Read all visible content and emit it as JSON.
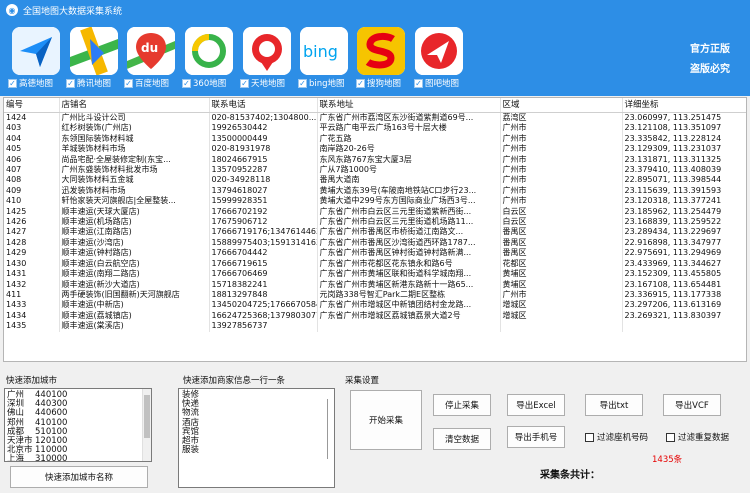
{
  "window": {
    "title": "全国地图大数据采集系统"
  },
  "apps": [
    {
      "label": "高德地图",
      "icon": "amap-icon",
      "color": "#1d8ef7"
    },
    {
      "label": "腾讯地图",
      "icon": "tencent-map-icon",
      "color": "#2c7cf6"
    },
    {
      "label": "百度地图",
      "icon": "baidu-map-icon",
      "color": "#e63a2e"
    },
    {
      "label": "360地图",
      "icon": "360-map-icon",
      "color": "#38b34a"
    },
    {
      "label": "天地地图",
      "icon": "tianditu-icon",
      "color": "#e8262a"
    },
    {
      "label": "bing地图",
      "icon": "bing-map-icon",
      "color": "#00a4ef"
    },
    {
      "label": "搜狗地图",
      "icon": "sogou-map-icon",
      "color": "#e60012"
    },
    {
      "label": "图吧地图",
      "icon": "mapbar-icon",
      "color": "#1d63c8"
    }
  ],
  "banner": {
    "official": "官方正版",
    "piracy": "盗版必究"
  },
  "table": {
    "columns": [
      "编号",
      "店铺名",
      "联系电话",
      "联系地址",
      "区域",
      "详细坐标"
    ],
    "rows": [
      [
        "1424",
        "广州比斗设计公司",
        "020-81537402;1304800...",
        "广东省广州市荔湾区东沙街道紫荆道69号...",
        "荔湾区",
        "23.060997, 113.251475"
      ],
      [
        "403",
        "红杉树装饰(广州店)",
        "19926530442",
        "平云路广电平云广场163号十层大楼",
        "广州市",
        "23.121108, 113.351097"
      ],
      [
        "404",
        "东领国际装饰材料城",
        "13500000449",
        "广花五路",
        "广州市",
        "23.335842, 113.228124"
      ],
      [
        "405",
        "羊城装饰材料市场",
        "020-81931978",
        "南岸路20-26号",
        "广州市",
        "23.129309, 113.231037"
      ],
      [
        "406",
        "尚品宅配·全屋装修定制(东宝...",
        "18024667915",
        "东风东路767东宝大厦3层",
        "广州市",
        "23.131871, 113.311325"
      ],
      [
        "407",
        "广州东盛装饰材料批发市场",
        "13570952287",
        "广从7路1000号",
        "广州市",
        "23.379410, 113.408039"
      ],
      [
        "408",
        "大同装饰材料五金城",
        "020-34928118",
        "番禺大道南",
        "广州市",
        "22.895071, 113.398544"
      ],
      [
        "409",
        "迅发装饰材料市场",
        "13794618027",
        "黄埔大道东39号(车陂南地铁站C口步行23...",
        "广州市",
        "23.115639, 113.391593"
      ],
      [
        "410",
        "轩怡家装天河旗舰店|全屋整装...",
        "15999928351",
        "黄埔大道中299号东方国际商业广场西3号...",
        "广州市",
        "23.120318, 113.377241"
      ],
      [
        "1425",
        "顺丰速运(天球大厦店)",
        "17666702192",
        "广东省广州市白云区三元里街道紫新西街...",
        "白云区",
        "23.185962, 113.254479"
      ],
      [
        "1426",
        "顺丰速运(机场路店)",
        "17675906712",
        "广东省广州市白云区三元里街道机场路11...",
        "白云区",
        "23.168839, 113.259522"
      ],
      [
        "1427",
        "顺丰速运(江南路店)",
        "17666719176;13476144636",
        "广东省广州市番禺区市桥街道江南路文...",
        "番禺区",
        "23.289434, 113.229697"
      ],
      [
        "1428",
        "顺丰速运(沙湾店)",
        "15889975403;15913141633",
        "广东省广州市番禺区沙湾街道西环路1787...",
        "番禺区",
        "22.916898, 113.347977"
      ],
      [
        "1429",
        "顺丰速运(钟村路店)",
        "17666704442",
        "广东省广州市番禺区钟村街道钟村路新满...",
        "番禺区",
        "22.975691, 113.294969"
      ],
      [
        "1430",
        "顺丰速运(白云航空店)",
        "17666719615",
        "广东省广州市花都区花东镇永和路6号",
        "花都区",
        "23.433969, 113.344627"
      ],
      [
        "1431",
        "顺丰速运(南翔二路店)",
        "17666706469",
        "广东省广州市黄埔区联和街道科学城南翔...",
        "黄埔区",
        "23.152309, 113.455805"
      ],
      [
        "1432",
        "顺丰速运(新沙大道店)",
        "15718382241",
        "广东省广州市黄埔区新港东路新十一路65...",
        "黄埔区",
        "23.167108, 113.654481"
      ],
      [
        "411",
        "两手硬装饰(旧国翻新)天河旗舰店",
        "18813297848",
        "元岗路338号智汇Park二期E区整栋",
        "广州市",
        "23.336915, 113.177338"
      ],
      [
        "1433",
        "顺丰速运(中新店)",
        "13450204725;17666705847",
        "广东省广州市增城区中新镇团结村金龙路...",
        "增城区",
        "23.297206, 113.613169"
      ],
      [
        "1434",
        "顺丰速运(荔城镇店)",
        "16624725368;13798030773",
        "广东省广州市增城区荔城镇荔景大道2号",
        "增城区",
        "23.269321, 113.830397"
      ],
      [
        "1435",
        "顺丰速运(棠溪店)",
        "13927856737",
        "",
        "",
        ""
      ]
    ]
  },
  "city_panel": {
    "title": "快速添加城市",
    "cities": [
      {
        "name": "广州",
        "code": "440100"
      },
      {
        "name": "深圳",
        "code": "440300"
      },
      {
        "name": "佛山",
        "code": "440600"
      },
      {
        "name": "郑州",
        "code": "410100"
      },
      {
        "name": "成都",
        "code": "510100"
      },
      {
        "name": "天津市",
        "code": "120100"
      },
      {
        "name": "北京市",
        "code": "110000"
      },
      {
        "name": "上海",
        "code": "310000"
      }
    ],
    "add_button": "快速添加城市名称"
  },
  "merchant_panel": {
    "title": "快速添加商家信息一行一条",
    "items": [
      "装修",
      "快递",
      "物流",
      "酒店",
      "宾馆",
      "超市",
      "服装"
    ]
  },
  "settings": {
    "title": "采集设置",
    "start": "开始采集",
    "stop": "停止采集",
    "clear": "清空数据",
    "export_excel": "导出Excel",
    "export_txt": "导出txt",
    "export_vcf": "导出VCF",
    "export_phone": "导出手机号",
    "filter_landline": "过滤座机号码",
    "filter_dup": "过滤重复数据",
    "count_label": "采集条共计：",
    "count_value": "1435条",
    "count_color": "#e60000"
  }
}
